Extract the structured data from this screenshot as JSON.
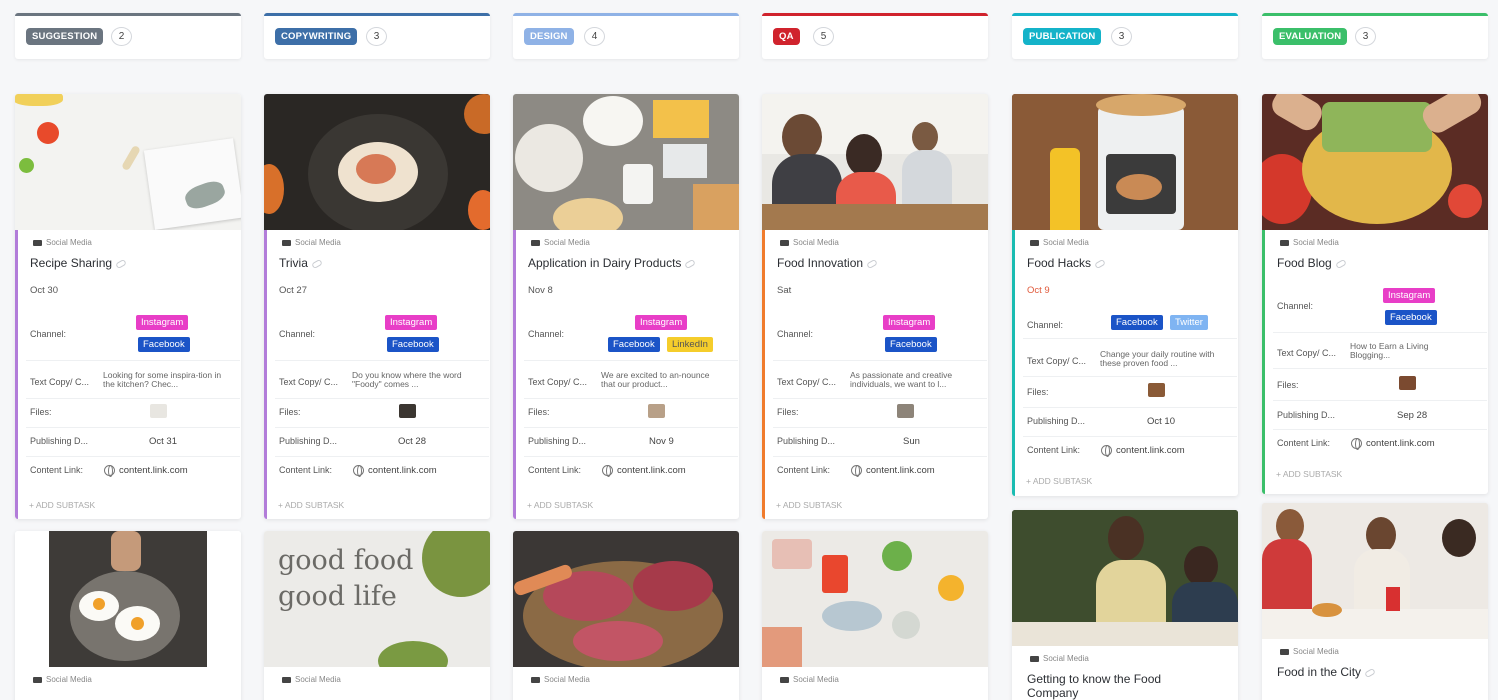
{
  "columns": [
    {
      "status": "SUGGESTION",
      "count": "2",
      "color": "#6b7580"
    },
    {
      "status": "COPYWRITING",
      "count": "3",
      "color": "#3d6fa8"
    },
    {
      "status": "DESIGN",
      "count": "4",
      "color": "#8fb2e6"
    },
    {
      "status": "QA",
      "count": "5",
      "color": "#d0232d"
    },
    {
      "status": "PUBLICATION",
      "count": "3",
      "color": "#14b3c9"
    },
    {
      "status": "EVALUATION",
      "count": "3",
      "color": "#3bbf6a"
    }
  ],
  "labels": {
    "list": "Social Media",
    "channel": "Channel:",
    "text_copy": "Text Copy/ C...",
    "files": "Files:",
    "publishing": "Publishing D...",
    "content_link": "Content Link:",
    "add_subtask": "+ ADD SUBTASK"
  },
  "cards": [
    {
      "title": "Recipe Sharing",
      "date": "Oct 30",
      "channels": [
        "Instagram",
        "Facebook"
      ],
      "copy": "Looking for some inspira-tion in the kitchen? Chec...",
      "publish": "Oct 31",
      "link": "content.link.com"
    },
    {
      "title": "Trivia",
      "date": "Oct 27",
      "channels": [
        "Instagram",
        "Facebook"
      ],
      "copy": "Do you know where the word \"Foody\" comes ...",
      "publish": "Oct 28",
      "link": "content.link.com"
    },
    {
      "title": "Application in Dairy Products",
      "date": "Nov 8",
      "channels": [
        "Instagram",
        "Facebook",
        "LinkedIn"
      ],
      "copy": "We are excited to an-nounce that our product...",
      "publish": "Nov 9",
      "link": "content.link.com"
    },
    {
      "title": "Food Innovation",
      "date": "Sat",
      "channels": [
        "Instagram",
        "Facebook"
      ],
      "copy": "As passionate and creative individuals, we want to l...",
      "publish": "Sun",
      "link": "content.link.com"
    },
    {
      "title": "Food Hacks",
      "date": "Oct 9",
      "channels": [
        "Facebook",
        "Twitter"
      ],
      "copy": "Change your daily routine with these proven food ...",
      "publish": "Oct 10",
      "link": "content.link.com"
    },
    {
      "title": "Food Blog",
      "date": "",
      "channels": [
        "Instagram",
        "Facebook"
      ],
      "copy": "How to Earn a Living Blogging...",
      "publish": "Sep 28",
      "link": "content.link.com"
    }
  ],
  "second_row": [
    {
      "title": ""
    },
    {
      "title": "",
      "image_text": [
        "good food",
        "good life"
      ]
    },
    {
      "title": ""
    },
    {
      "title": ""
    },
    {
      "title": "Getting to know the Food Company"
    },
    {
      "title": "Food in the City"
    }
  ]
}
